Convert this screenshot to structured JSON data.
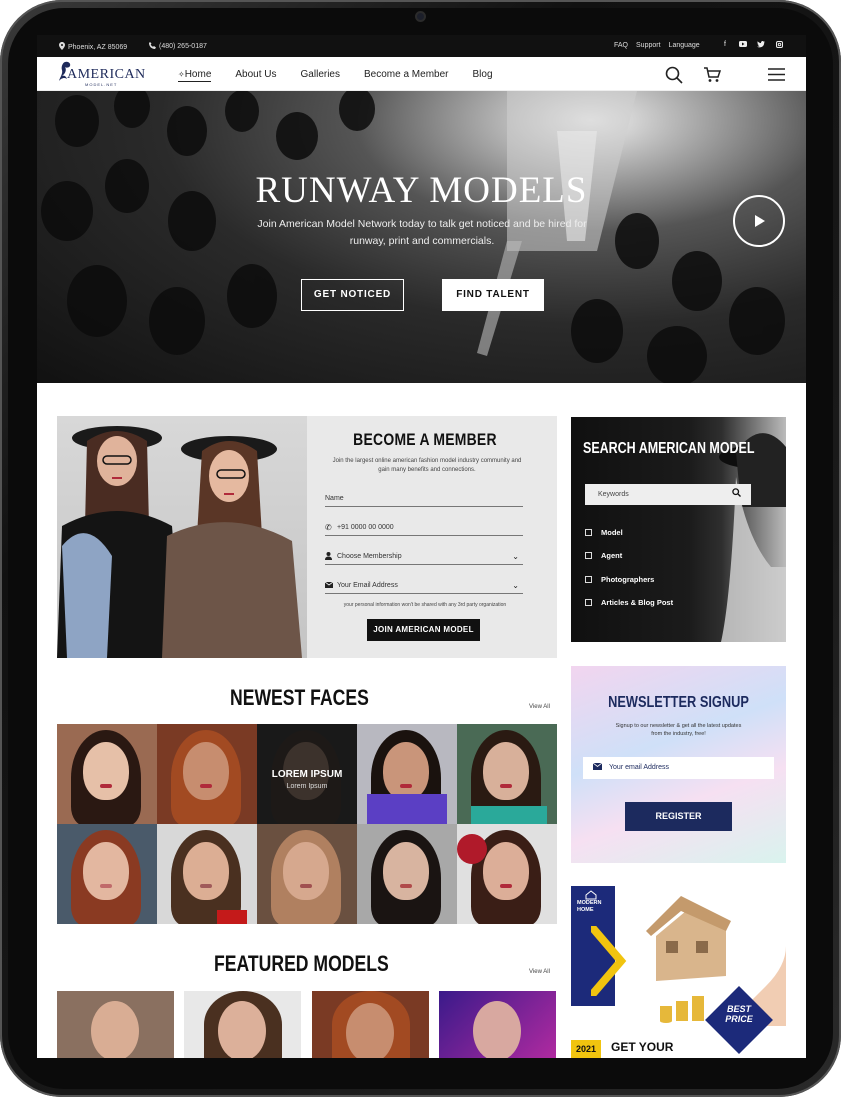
{
  "topbar": {
    "location": "Phoenix, AZ 85069",
    "phone": "(480) 265-0187",
    "links": [
      "FAQ",
      "Support",
      "Language"
    ],
    "social_icons": [
      "facebook-icon",
      "youtube-icon",
      "twitter-icon",
      "instagram-icon"
    ]
  },
  "nav": {
    "logo_text": "AMERICAN",
    "logo_sub": "MODEL.NET",
    "items": [
      "Home",
      "About Us",
      "Galleries",
      "Become a Member",
      "Blog"
    ],
    "active": "Home"
  },
  "hero": {
    "title": "RUNWAY MODELS",
    "subtitle": "Join American Model Network today to talk get noticed and be hired for runway, print and commercials.",
    "btn_primary": "GET NOTICED",
    "btn_secondary": "FIND TALENT"
  },
  "member": {
    "title": "BECOME A MEMBER",
    "description": "Join the largest online american fashion model industry community and gain many benefits and connections.",
    "name_placeholder": "Name",
    "phone_placeholder": "+91 0000 00 0000",
    "membership_placeholder": "Choose Membership",
    "email_placeholder": "Your Email Address",
    "note": "your personal information won't be shared with any 3rd party organization",
    "submit": "JOIN AMERICAN MODEL"
  },
  "search": {
    "title": "SEARCH AMERICAN MODEL",
    "placeholder": "Keywords",
    "options": [
      "Model",
      "Agent",
      "Photographers",
      "Articles & Blog Post"
    ]
  },
  "newest": {
    "title": "NEWEST FACES",
    "view_all": "View All",
    "overlay_title": "LOREM IPSUM",
    "overlay_sub": "Lorem Ipsum"
  },
  "featured": {
    "title": "FEATURED MODELS",
    "view_all": "View All"
  },
  "newsletter": {
    "title": "NEWSLETTER SIGNUP",
    "description": "Signup to our newsletter & get all the latest updates from the industry, free!",
    "placeholder": "Your email Address",
    "button": "REGISTER"
  },
  "ad": {
    "tag": "MODERN HOME",
    "badge": "BEST PRICE",
    "year": "2021",
    "headline": "GET YOUR"
  },
  "colors": {
    "navy": "#1c2a5e",
    "black": "#111111"
  }
}
